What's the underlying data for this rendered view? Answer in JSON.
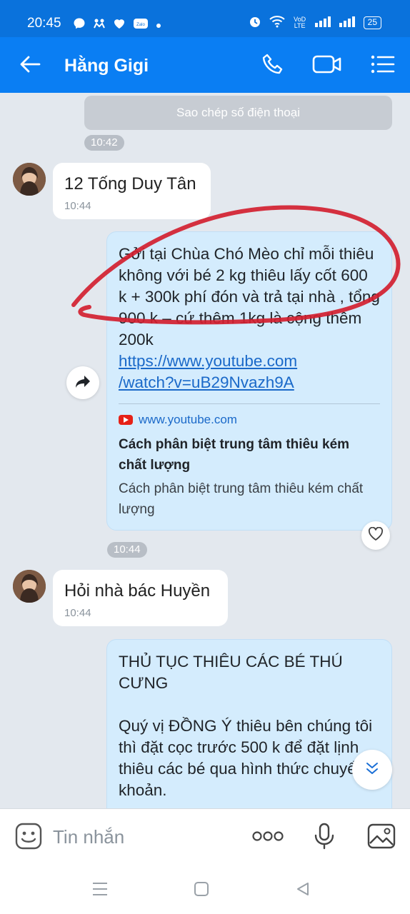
{
  "status_bar": {
    "time": "20:45",
    "network_label": "VoD LTE",
    "battery": "25"
  },
  "header": {
    "title": "Hằng Gigi",
    "accent_color": "#0a7ef3"
  },
  "chat": {
    "system_action": "Sao chép số điện thoại",
    "time_1": "10:42",
    "msg_1": {
      "text": "12 Tống Duy Tân",
      "time": "10:44"
    },
    "msg_2": {
      "text": "Gởi tại Chùa Chó Mèo chỉ mỗi thiêu không với bé  2 kg thiêu lấy cốt 600 k + 300k phí đón và trả tại nhà , tổng 900 k – cứ thêm 1kg là cộng thêm 200k",
      "link_line_1": "https://www.youtube.com",
      "link_line_2": "/watch?v=uB29Nvazh9A",
      "preview_domain": "www.youtube.com",
      "preview_title": "Cách phân biệt trung tâm thiêu kém chất lượng",
      "preview_description": "Cách phân biệt trung tâm thiêu kém chất lượng"
    },
    "time_2": "10:44",
    "msg_3": {
      "text": "Hỏi nhà bác Huyền",
      "time": "10:44"
    },
    "msg_4": {
      "title": "THỦ TỤC THIÊU CÁC BÉ THÚ CƯNG",
      "text": "Quý vị ĐỒNG Ý thiêu bên chúng tôi thì đặt cọc trước 500 k để đặt lịnh thiêu các bé qua hình thức chuyển khoản."
    },
    "annotation_color": "#d32030"
  },
  "composer": {
    "placeholder": "Tin nhắn",
    "more_label": "ooo"
  },
  "icons": {
    "back": "back-arrow-icon",
    "call": "phone-icon",
    "video": "video-camera-icon",
    "menu": "list-menu-icon",
    "forward": "share-forward-icon",
    "react": "heart-icon",
    "scroll_down": "chevron-down-icon",
    "sticker": "sticker-icon",
    "voice": "microphone-icon",
    "image": "image-icon"
  }
}
